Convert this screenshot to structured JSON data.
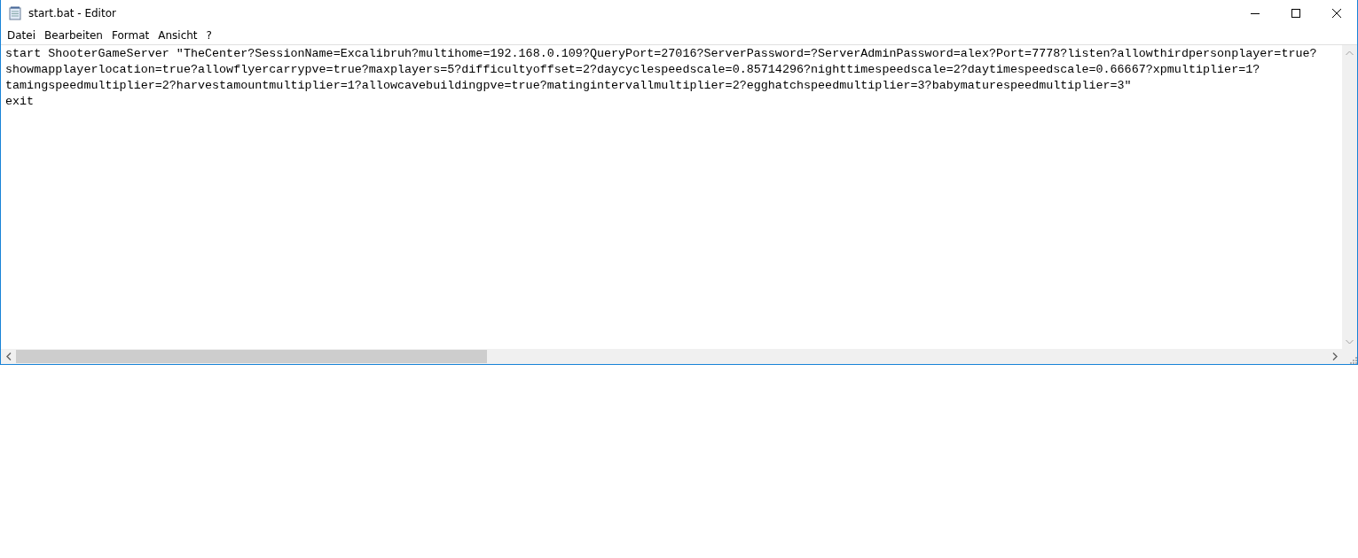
{
  "window": {
    "title": "start.bat - Editor"
  },
  "menu": [
    {
      "label": "Datei"
    },
    {
      "label": "Bearbeiten"
    },
    {
      "label": "Format"
    },
    {
      "label": "Ansicht"
    },
    {
      "label": "?"
    }
  ],
  "editor": {
    "lines": [
      "start ShooterGameServer \"TheCenter?SessionName=Excalibruh?multihome=192.168.0.109?QueryPort=27016?ServerPassword=?ServerAdminPassword=alex?Port=7778?listen?allowthirdpersonplayer=true?",
      "showmapplayerlocation=true?allowflyercarrypve=true?maxplayers=5?difficultyoffset=2?daycyclespeedscale=0.85714296?nighttimespeedscale=2?daytimespeedscale=0.66667?xpmultiplier=1?",
      "tamingspeedmultiplier=2?harvestamountmultiplier=1?allowcavebuildingpve=true?matingintervallmultiplier=2?egghatchspeedmultiplier=3?babymaturespeedmultiplier=3\"",
      "exit"
    ]
  }
}
